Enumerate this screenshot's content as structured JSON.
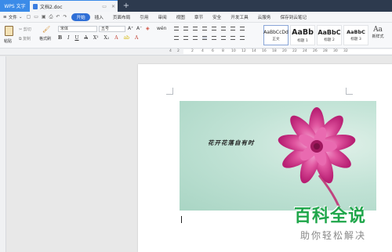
{
  "titlebar": {
    "app_tab": "WPS 文字",
    "doc_tab": "文档2.doc",
    "new_tab_icon": "plus-icon"
  },
  "menubar": {
    "file": "文件",
    "items": [
      "开始",
      "插入",
      "页面布局",
      "引用",
      "审阅",
      "视图",
      "章节",
      "安全",
      "开发工具",
      "云服务",
      "保存到云笔记"
    ],
    "active_index": 0,
    "active_color": "#2f6fd6"
  },
  "ribbon": {
    "paste_label": "粘贴",
    "cut_label": "剪切",
    "copy_label": "复制",
    "format_painter_label": "格式刷",
    "font_name": "宋体",
    "font_size": "五号",
    "bold": "B",
    "italic": "I",
    "underline": "U",
    "strike": "A",
    "superscript": "X²",
    "subscript": "X₂",
    "styles": [
      {
        "sample": "AaBbCcDd",
        "label": "正文"
      },
      {
        "sample": "AaBb",
        "label": "标题 1"
      },
      {
        "sample": "AaBbC",
        "label": "标题 2"
      },
      {
        "sample": "AaBbC",
        "label": "标题 3"
      }
    ],
    "new_style_label": "新样式"
  },
  "ruler": {
    "numbers": [
      "4",
      "2",
      "2",
      "4",
      "6",
      "8",
      "10",
      "12",
      "14",
      "16",
      "18",
      "20",
      "22",
      "24",
      "26",
      "28",
      "30",
      "32"
    ]
  },
  "document": {
    "image_caption": "花开花落自有时"
  },
  "watermark": {
    "title": "百科全说",
    "subtitle": "助你轻松解决",
    "color": "#1fa64a"
  }
}
